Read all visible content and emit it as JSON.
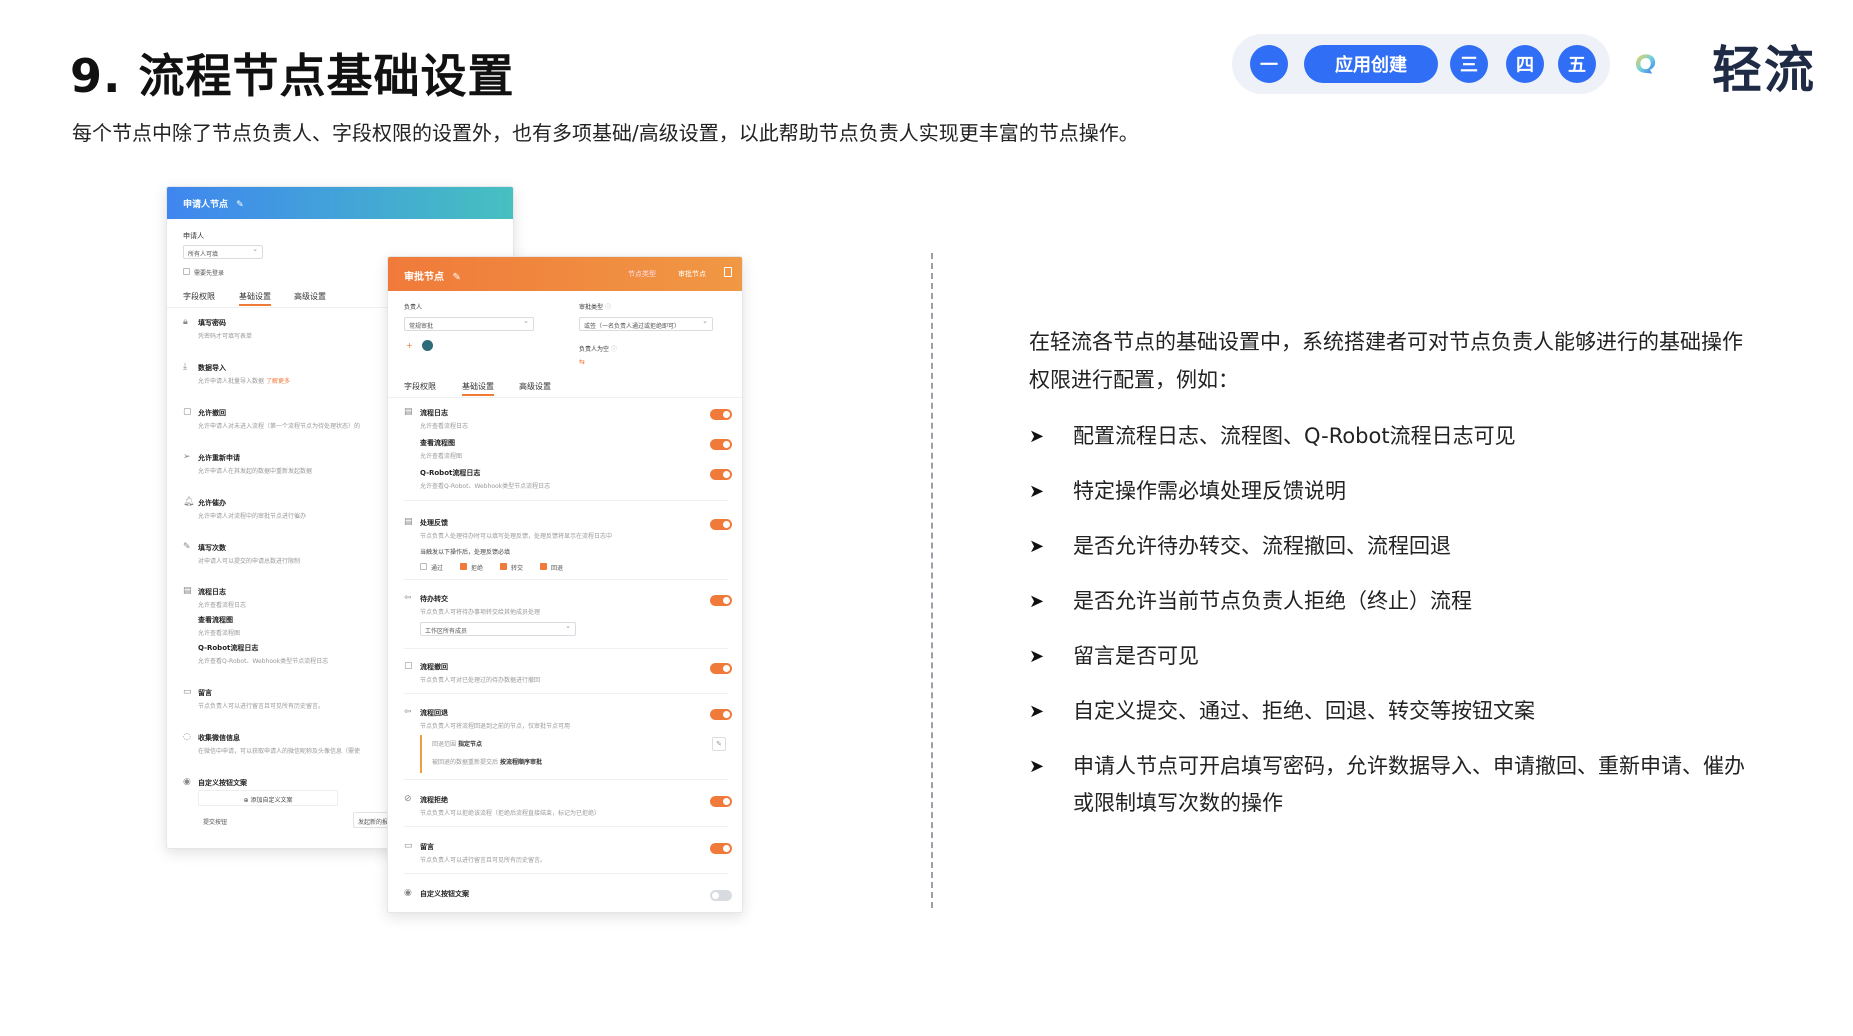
{
  "slide": {
    "title": "9. 流程节点基础设置",
    "subtitle": "每个节点中除了节点负责人、字段权限的设置外，也有多项基础/高级设置，以此帮助节点负责人实现更丰富的节点操作。"
  },
  "step_nav": {
    "items": [
      "一",
      "应用创建",
      "三",
      "四",
      "五"
    ],
    "active_color": "#2f6ef5"
  },
  "logo": {
    "text": "轻流",
    "icon": "q-logo-icon"
  },
  "right": {
    "intro": "在轻流各节点的基础设置中，系统搭建者可对节点负责人能够进行的基础操作权限进行配置，例如：",
    "bullets": [
      "配置流程日志、流程图、Q-Robot流程日志可见",
      "特定操作需必填处理反馈说明",
      "是否允许待办转交、流程撤回、流程回退",
      "是否允许当前节点负责人拒绝（终止）流程",
      "留言是否可见",
      "自定义提交、通过、拒绝、回退、转交等按钮文案",
      "申请人节点可开启填写密码，允许数据导入、申请撤回、重新申请、催办或限制填写次数的操作"
    ]
  },
  "panel_a": {
    "header": "申请人节点",
    "applicant_label": "申请人",
    "applicant_select": "所有人可填",
    "login_required": "需要先登录",
    "tabs": [
      "字段权限",
      "基础设置",
      "高级设置"
    ],
    "items": [
      {
        "title": "填写密码",
        "desc": "凭密码才可填写表单"
      },
      {
        "title": "数据导入",
        "desc": "允许申请人批量导入数据",
        "link": "了解更多"
      },
      {
        "title": "允许撤回",
        "desc": "允许申请人对未进入流程（第一个流程节点为待处理状态）的"
      },
      {
        "title": "允许重新申请",
        "desc": "允许申请人在其发起的数据中重新发起数据"
      },
      {
        "title": "允许催办",
        "desc": "允许申请人对流程中的审批节点进行催办"
      },
      {
        "title": "填写次数",
        "desc": "对申请人可以提交的申请总数进行限制"
      },
      {
        "title": "流程日志",
        "desc": "允许查看流程日志"
      },
      {
        "title": "查看流程图",
        "desc": "允许查看流程图"
      },
      {
        "title": "Q-Robot流程日志",
        "desc": "允许查看Q-Robot、Webhook类型节点流程日志"
      },
      {
        "title": "留言",
        "desc": "节点负责人可以进行留言且可见所有历史留言。"
      },
      {
        "title": "收集微信信息",
        "desc": "在微信中申请，可以获取申请人的微信昵称及头像信息（需使"
      },
      {
        "title": "自定义按钮文案",
        "desc": ""
      }
    ],
    "add_custom": "添加自定义文案",
    "submit_btn": "提交按钮",
    "initiate": "发起新的报"
  },
  "panel_b": {
    "header": "审批节点",
    "header_right_1": "节点类型",
    "header_right_2": "审批节点",
    "owner_label": "负责人",
    "owner_select": "常规审批",
    "approve_type_label": "审批类型",
    "approve_type_select": "或签（一名负责人通过或拒绝即可）",
    "empty_owner_label": "负责人为空",
    "tabs": [
      "字段权限",
      "基础设置",
      "高级设置"
    ],
    "log_items": [
      {
        "title": "流程日志",
        "desc": "允许查看流程日志"
      },
      {
        "title": "查看流程图",
        "desc": "允许查看流程图"
      },
      {
        "title": "Q-Robot流程日志",
        "desc": "允许查看Q-Robot、Webhook类型节点流程日志"
      }
    ],
    "feedback": {
      "title": "处理反馈",
      "desc": "节点负责人处理待办时可以填写处理反馈，处理反馈将显示在流程日志中",
      "cond": "当触发以下操作后，处理反馈必填",
      "options": [
        "通过",
        "拒绝",
        "转交",
        "回退"
      ]
    },
    "transfer": {
      "title": "待办转交",
      "desc": "节点负责人可将待办事项转交给其他成员处理",
      "select": "工作区所有成员"
    },
    "withdraw": {
      "title": "流程撤回",
      "desc": "节点负责人可对已处理过的待办数据进行撤回"
    },
    "rollback": {
      "title": "流程回退",
      "desc": "节点负责人可将流程回退到之前的节点，仅审批节点可用",
      "range_label": "回退范围",
      "range_value": "指定节点",
      "resubmit_label": "被回退的数据重新提交后",
      "resubmit_value": "按流程顺序审批"
    },
    "reject": {
      "title": "流程拒绝",
      "desc": "节点负责人可以拒绝该流程（拒绝后流程直接结束，标记为已拒绝）"
    },
    "comment": {
      "title": "留言",
      "desc": "节点负责人可以进行留言且可见所有历史留言。"
    },
    "custom_btn": {
      "title": "自定义按钮文案"
    }
  }
}
